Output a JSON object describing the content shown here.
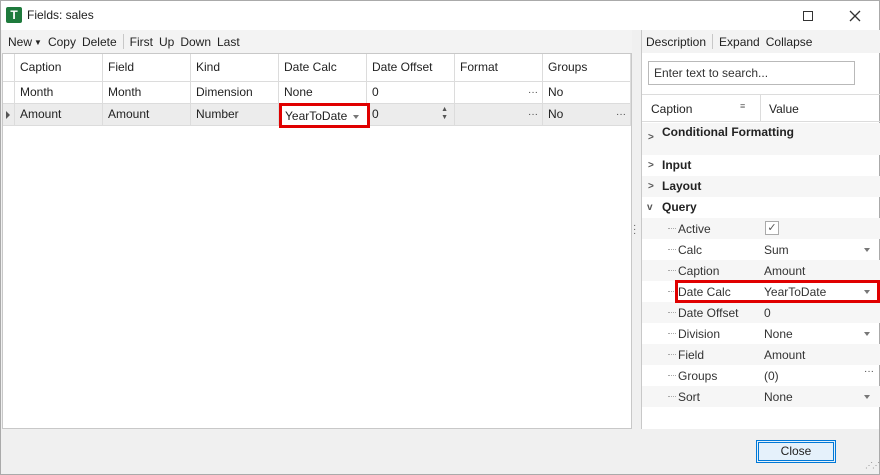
{
  "window": {
    "title": "Fields: sales",
    "app_icon_letter": "T"
  },
  "toolbar": {
    "new": "New",
    "copy": "Copy",
    "delete": "Delete",
    "first": "First",
    "up": "Up",
    "down": "Down",
    "last": "Last"
  },
  "grid": {
    "columns": [
      "Caption",
      "Field",
      "Kind",
      "Date Calc",
      "Date Offset",
      "Format",
      "Groups"
    ],
    "rows": [
      {
        "caption": "Month",
        "field": "Month",
        "kind": "Dimension",
        "date_calc": "None",
        "date_offset": "0",
        "format": "",
        "groups": "No"
      },
      {
        "caption": "Amount",
        "field": "Amount",
        "kind": "Number",
        "date_calc": "YearToDate",
        "date_offset": "0",
        "format": "",
        "groups": "No"
      }
    ]
  },
  "property_panel": {
    "toolbar": {
      "description": "Description",
      "expand": "Expand",
      "collapse": "Collapse"
    },
    "search_placeholder": "Enter text to search...",
    "header": {
      "caption": "Caption",
      "value": "Value"
    },
    "categories": {
      "conditional_formatting": "Conditional Formatting",
      "input": "Input",
      "layout": "Layout",
      "query": "Query"
    },
    "properties": [
      {
        "label": "Active",
        "value": ""
      },
      {
        "label": "Calc",
        "value": "Sum"
      },
      {
        "label": "Caption",
        "value": "Amount"
      },
      {
        "label": "Date Calc",
        "value": "YearToDate"
      },
      {
        "label": "Date Offset",
        "value": "0"
      },
      {
        "label": "Division",
        "value": "None"
      },
      {
        "label": "Field",
        "value": "Amount"
      },
      {
        "label": "Groups",
        "value": "(0)"
      },
      {
        "label": "Sort",
        "value": "None"
      }
    ],
    "active_checked": true
  },
  "buttons": {
    "close": "Close"
  },
  "colors": {
    "highlight": "#e00000",
    "app_icon": "#1e7a3c",
    "accent": "#0078d7"
  }
}
